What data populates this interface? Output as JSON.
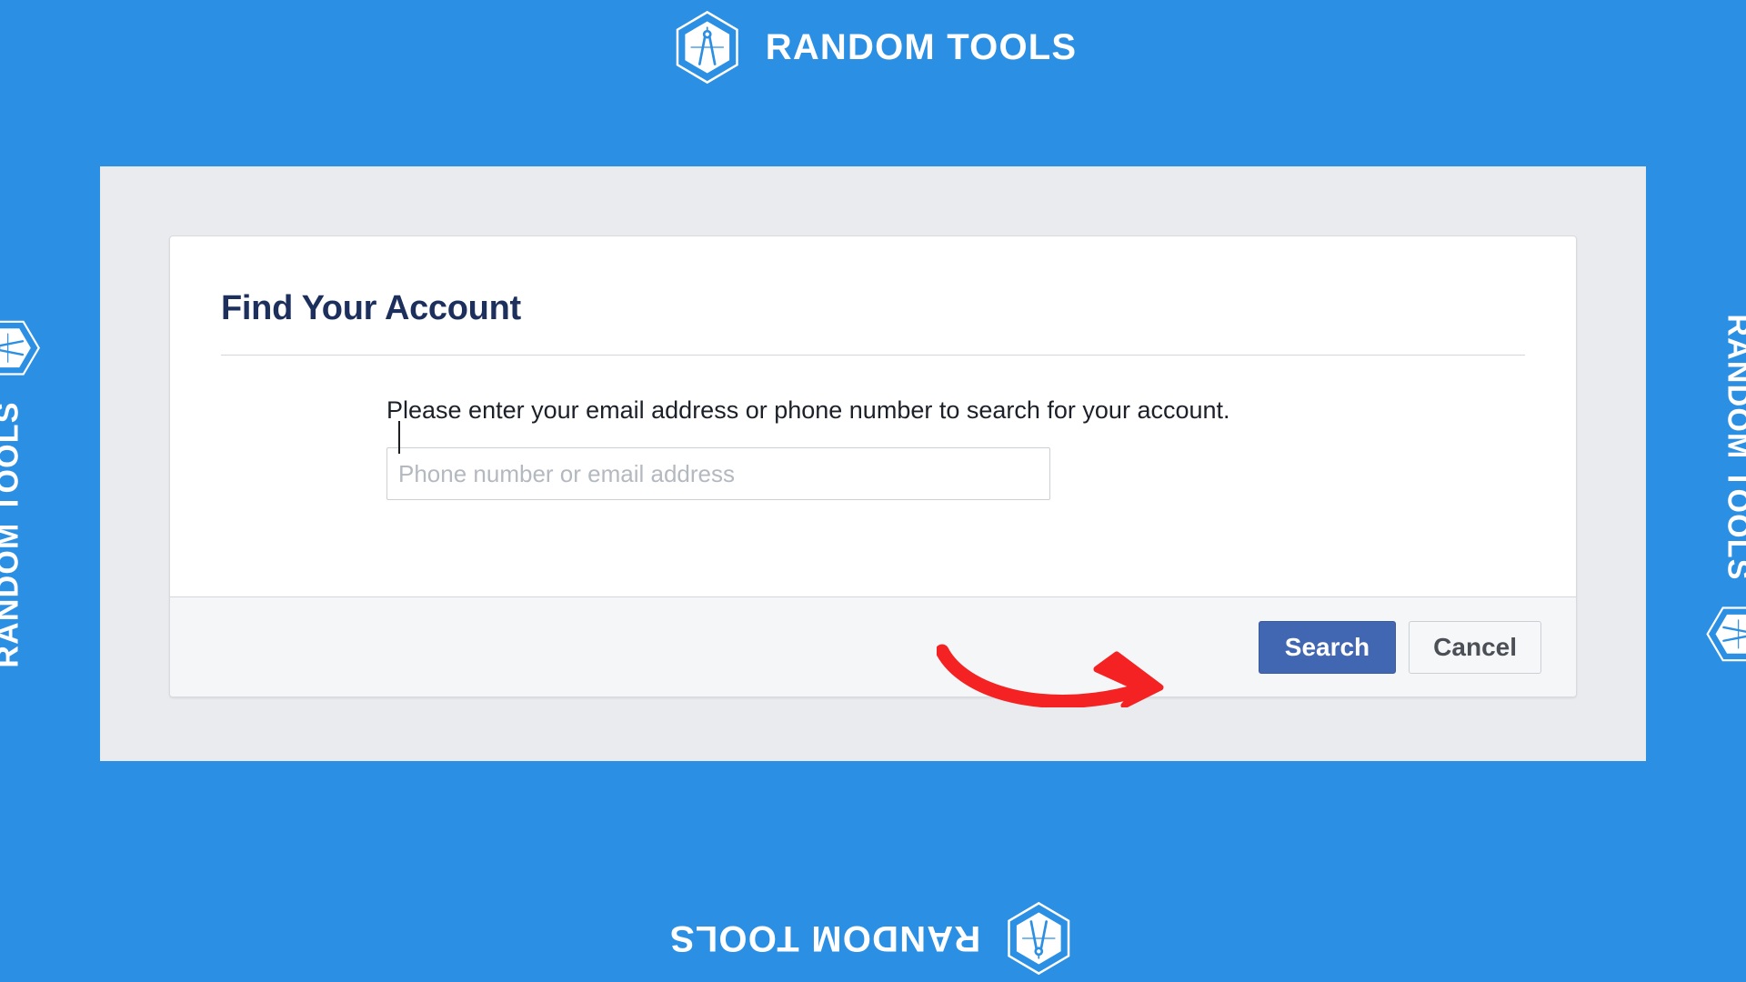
{
  "brand": {
    "name": "RANDOM TOOLS",
    "logo_icon": "hexagon-compass-icon",
    "background_color": "#2b8fe3",
    "text_color": "#ffffff"
  },
  "dialog": {
    "title": "Find Your Account",
    "title_color": "#1d2f5c",
    "panel_color": "#e9ebee",
    "card_color": "#ffffff",
    "body_text": "Please enter your email address or phone number to search for your account.",
    "input": {
      "placeholder": "Phone number or email address",
      "value": "",
      "has_caret": true
    },
    "footer": {
      "background_color": "#f5f6f7",
      "primary_button": {
        "label": "Search",
        "color": "#4267b2"
      },
      "secondary_button": {
        "label": "Cancel",
        "color": "#f6f7f8"
      }
    }
  },
  "annotation": {
    "arrow_icon": "curved-right-arrow-icon",
    "color": "#f42222",
    "points_to": "Search"
  }
}
